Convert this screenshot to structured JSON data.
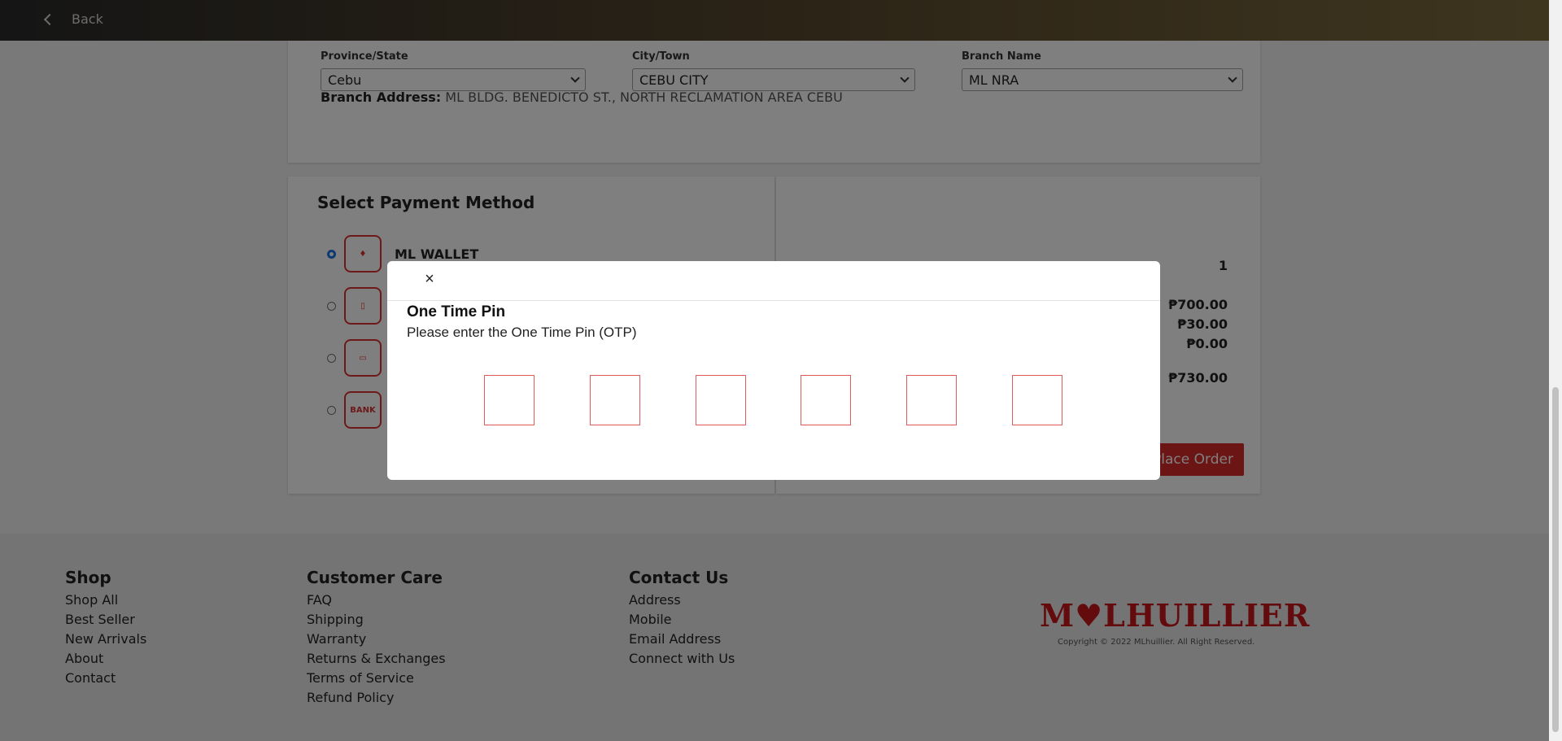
{
  "topbar": {
    "back_label": "Back"
  },
  "branch": {
    "province": {
      "label": "Province/State",
      "value": "Cebu"
    },
    "city": {
      "label": "City/Town",
      "value": "CEBU CITY"
    },
    "branch_name": {
      "label": "Branch Name",
      "value": "ML NRA"
    },
    "address_label": "Branch Address:",
    "address_value": "ML BLDG. BENEDICTO ST., NORTH RECLAMATION AREA CEBU"
  },
  "payment": {
    "title": "Select Payment Method",
    "methods": [
      {
        "label": "ML WALLET",
        "icon": "ml-wallet-icon",
        "selected": true
      },
      {
        "label": "",
        "icon": "mobile-payment-icon",
        "selected": false
      },
      {
        "label": "",
        "icon": "card-icon",
        "selected": false
      },
      {
        "label": "BANK",
        "icon": "bank-icon",
        "selected": false
      }
    ]
  },
  "summary": {
    "quantity": "1",
    "subtotal": "₱700.00",
    "shipping": "₱30.00",
    "discount": "₱0.00",
    "total": "₱730.00",
    "place_order_label": "Place Order"
  },
  "modal": {
    "close_symbol": "×",
    "title": "One Time Pin",
    "subtitle": "Please enter the One Time Pin (OTP)",
    "otp_digits": [
      "",
      "",
      "",
      "",
      "",
      ""
    ]
  },
  "footer": {
    "shop": {
      "heading": "Shop",
      "links": [
        "Shop All",
        "Best Seller",
        "New Arrivals",
        "About",
        "Contact"
      ]
    },
    "care": {
      "heading": "Customer Care",
      "links": [
        "FAQ",
        "Shipping",
        "Warranty",
        "Returns & Exchanges",
        "Terms of Service",
        "Refund Policy"
      ]
    },
    "contact": {
      "heading": "Contact Us",
      "links": [
        "Address",
        "Mobile",
        "Email Address",
        "Connect with Us"
      ]
    },
    "logo_text": "M♥LHUILLIER",
    "copyright": "Copyright © 2022 MLhuillier. All Right Reserved."
  },
  "colors": {
    "brand_red": "#d62b2b",
    "otp_border": "#e05a5a",
    "topbar_gold": "#7d6b3f"
  }
}
